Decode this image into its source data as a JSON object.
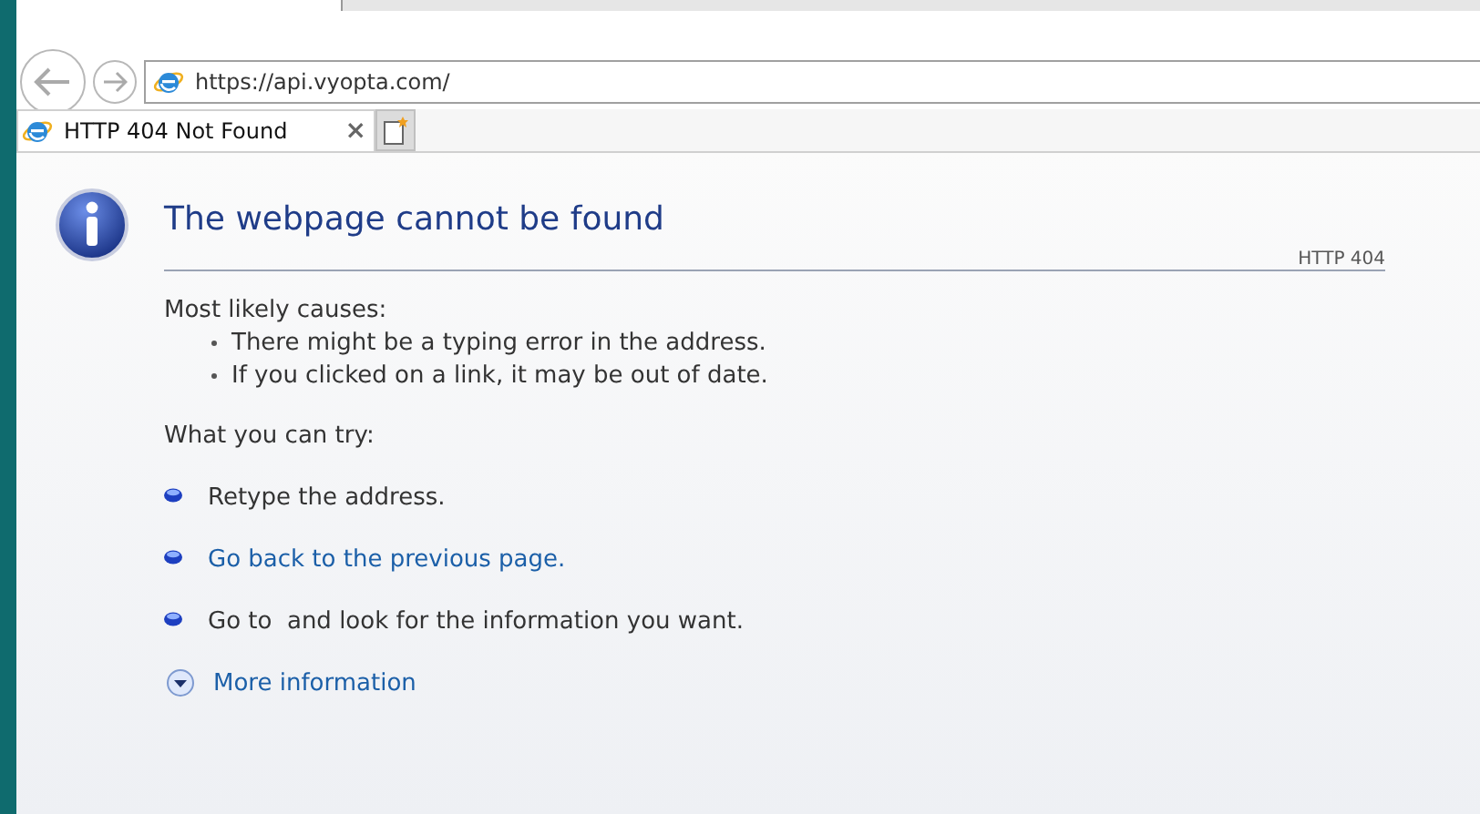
{
  "address_bar": {
    "url": "https://api.vyopta.com/"
  },
  "tabs": [
    {
      "label": "HTTP 404 Not Found",
      "close": "×",
      "selected": true
    }
  ],
  "page": {
    "title": "The webpage cannot be found",
    "code": "HTTP 404",
    "causes_heading": "Most likely causes:",
    "causes": [
      "There might be a typing error in the address.",
      "If you clicked on a link, it may be out of date."
    ],
    "try_heading": "What you can try:",
    "suggestions": [
      {
        "kind": "text",
        "text": "Retype the address."
      },
      {
        "kind": "link",
        "text": "Go back to the previous page."
      },
      {
        "kind": "text",
        "text": "Go to  and look for the information you want."
      }
    ],
    "more": "More information"
  }
}
